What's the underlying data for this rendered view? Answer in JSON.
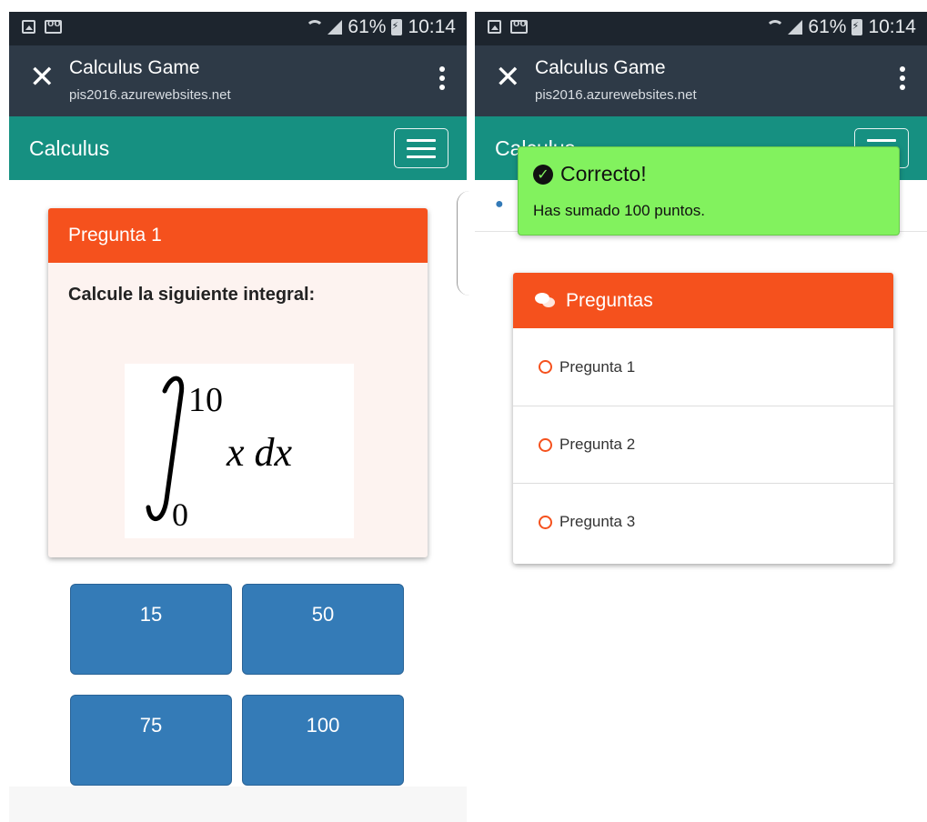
{
  "status_bar": {
    "battery": "61%",
    "time": "10:14"
  },
  "app_bar": {
    "title": "Calculus Game",
    "url": "pis2016.azurewebsites.net"
  },
  "navbar": {
    "brand": "Calculus"
  },
  "question": {
    "header": "Pregunta 1",
    "prompt": "Calcule la siguiente integral:",
    "formula": {
      "upper": "10",
      "lower": "0",
      "integrand": "x dx"
    }
  },
  "answers": [
    "15",
    "50",
    "75",
    "100"
  ],
  "toast": {
    "title": "Correcto!",
    "message": "Has sumado 100 puntos."
  },
  "questions_panel": {
    "title": "Preguntas",
    "items": [
      "Pregunta 1",
      "Pregunta 2",
      "Pregunta 3"
    ]
  },
  "colors": {
    "status_bar": "#1d252e",
    "app_bar": "#2e3a47",
    "navbar": "#169081",
    "panel_header": "#f5511d",
    "answer_button": "#347bb7",
    "toast": "#82f25e"
  }
}
